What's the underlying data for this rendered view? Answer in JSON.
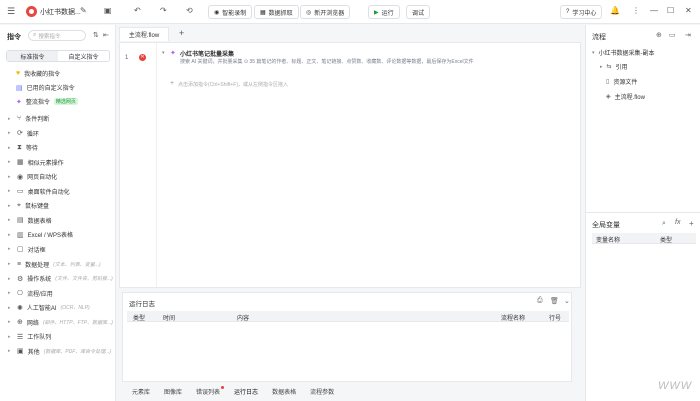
{
  "titlebar": {
    "file_title": "小红书数据...",
    "buttons": [
      "智能录制",
      "数据抓取",
      "新开浏览器"
    ],
    "run_label": "运行",
    "debug_label": "调试",
    "help_label": "学习中心"
  },
  "sidebar": {
    "title": "指令",
    "search_placeholder": "搜索指令",
    "tabs": [
      "标准指令",
      "自定义指令"
    ],
    "quick": [
      {
        "label": "我收藏的指令",
        "color": "#f5b400"
      },
      {
        "label": "已用的自定义指令",
        "color": "#5b6bff"
      },
      {
        "label": "整流指令",
        "badge": "精选网页"
      }
    ],
    "items": [
      {
        "label": "条件判断"
      },
      {
        "label": "循环"
      },
      {
        "label": "等待"
      },
      {
        "label": "相似元素操作"
      },
      {
        "label": "网页自动化"
      },
      {
        "label": "桌面软件自动化"
      },
      {
        "label": "鼠标键盘"
      },
      {
        "label": "数据表格"
      },
      {
        "label": "Excel / WPS表格"
      },
      {
        "label": "对话框"
      },
      {
        "label": "数据处理",
        "hint": "(文本、列表、变量...)"
      },
      {
        "label": "操作系统",
        "hint": "(文件、文件夹、剪贴板...)"
      },
      {
        "label": "流程/应用"
      },
      {
        "label": "人工智能AI",
        "hint": "(OCR、NLP)"
      },
      {
        "label": "网络",
        "hint": "(邮件、HTTP、FTP、数据库...)"
      },
      {
        "label": "工作队列"
      },
      {
        "label": "其他",
        "hint": "(数据库、PDF、库命令处理...)"
      }
    ]
  },
  "editor": {
    "tab_label": "主流程.flow",
    "add_tab": "+",
    "line_no": "1",
    "step_title": "小红书笔记批量采集",
    "step_desc": "搜索 AI 关键词，并批量采集 ⊙ 35 篇笔记的作者、标题、正文、笔记链接、点赞数、收藏数、评论数据等数据，最后保存为Excel文件",
    "add_hint": "点击添加指令(Ctrl+Shift+F)，或从左侧指令区拖入"
  },
  "log": {
    "title": "运行日志",
    "columns": [
      "类型",
      "时间",
      "内容",
      "流程名称",
      "行号"
    ]
  },
  "bottom_tabs": [
    "元素库",
    "图像库",
    "错误列表",
    "运行日志",
    "数据表格",
    "流程参数"
  ],
  "flow": {
    "title": "流程",
    "items": [
      "小红书数据采集-副本",
      "引用",
      "资源文件",
      "主流程.flow"
    ]
  },
  "vars": {
    "title": "全局变量",
    "columns": [
      "变量名称",
      "类型"
    ]
  },
  "watermark": "WWW"
}
